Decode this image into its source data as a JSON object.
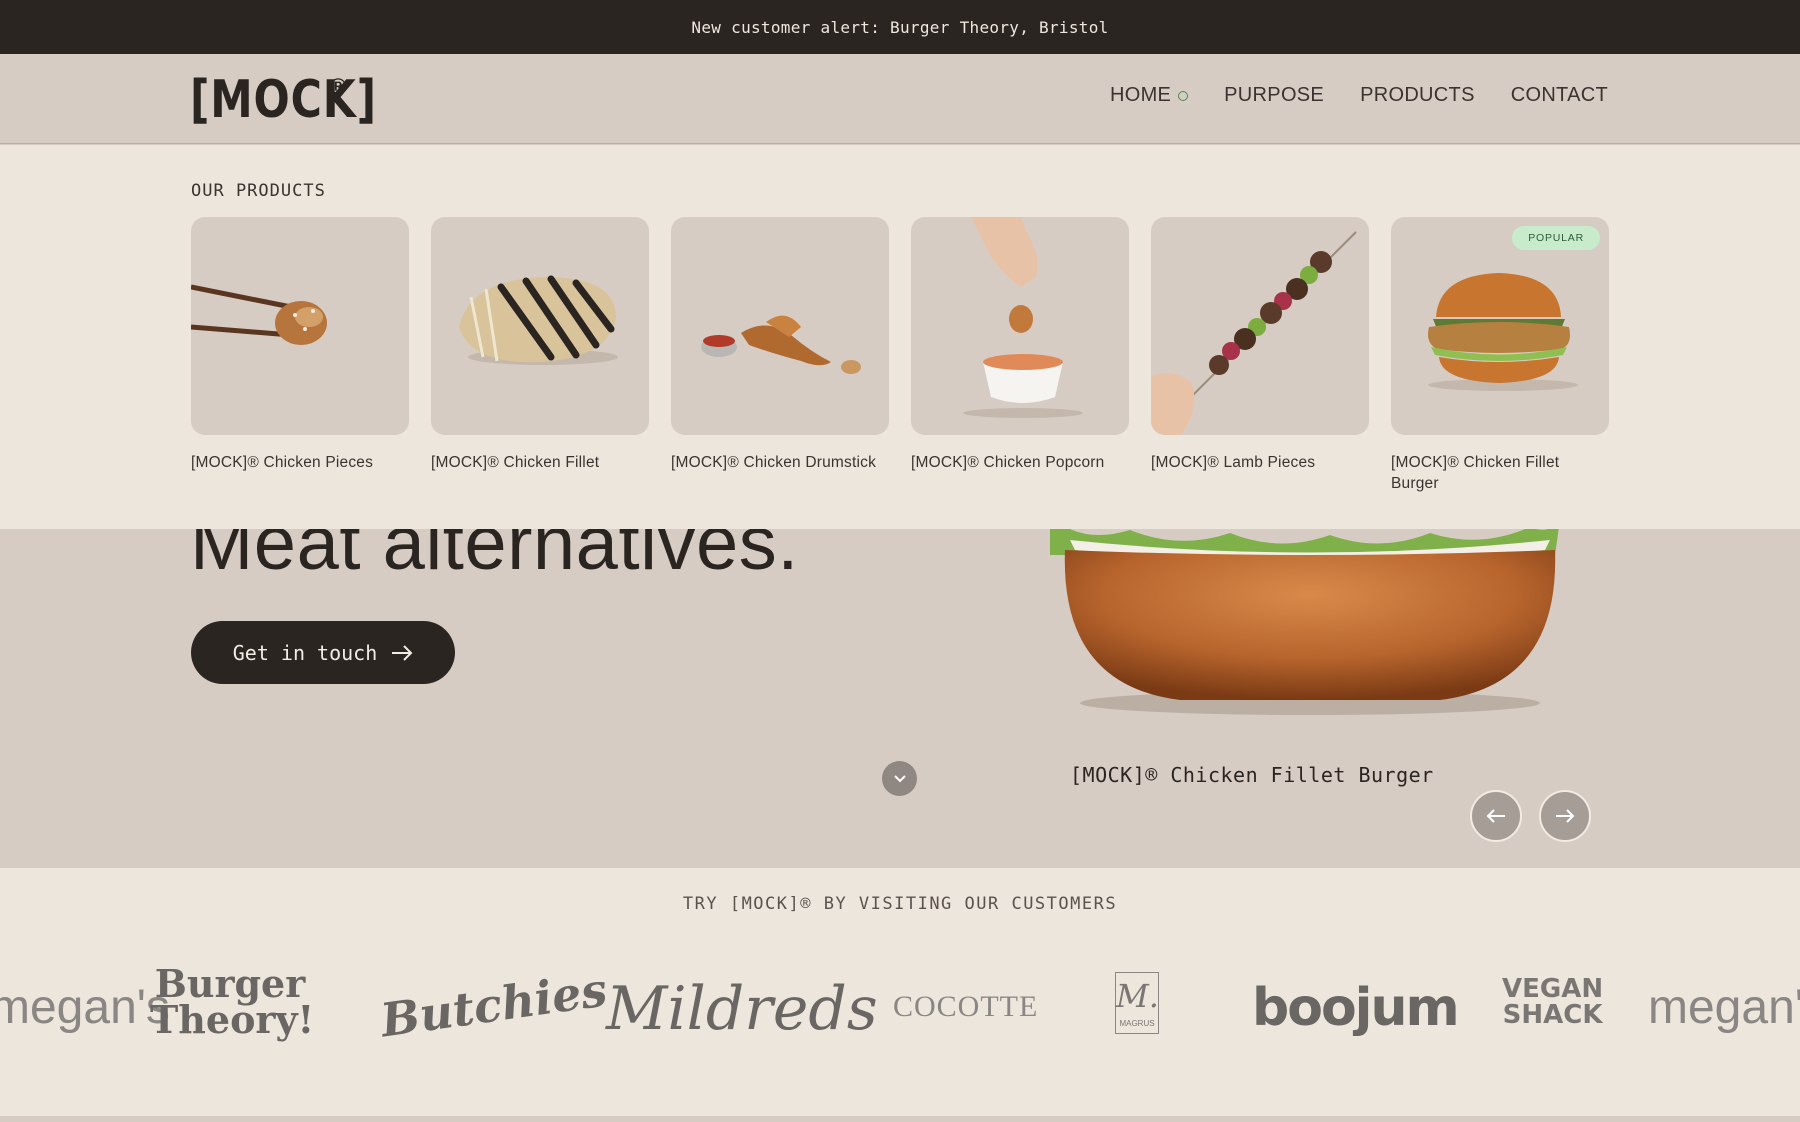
{
  "announcement": "New customer alert: Burger Theory, Bristol",
  "brand": {
    "logo_text": "[MOCK]",
    "logo_mark": "®"
  },
  "nav": {
    "items": [
      {
        "label": "HOME",
        "active": true
      },
      {
        "label": "PURPOSE"
      },
      {
        "label": "PRODUCTS"
      },
      {
        "label": "CONTACT"
      }
    ]
  },
  "products_panel": {
    "title": "OUR PRODUCTS",
    "products": [
      {
        "name": "[MOCK]® Chicken Pieces"
      },
      {
        "name": "[MOCK]® Chicken Fillet"
      },
      {
        "name": "[MOCK]® Chicken Drumstick"
      },
      {
        "name": "[MOCK]® Chicken Popcorn"
      },
      {
        "name": "[MOCK]® Lamb Pieces"
      },
      {
        "name": "[MOCK]® Chicken Fillet Burger",
        "badge": "POPULAR"
      }
    ]
  },
  "hero": {
    "heading": "Meat alternatives.",
    "cta_label": "Get in touch",
    "caption": "[MOCK]® Chicken Fillet Burger"
  },
  "customers": {
    "title": "TRY [MOCK]® BY VISITING OUR CUSTOMERS",
    "logos": [
      "megan's",
      "Burger Theory!",
      "Butchies",
      "Mildreds",
      "COCOTTE",
      "M.",
      "MAGRUS",
      "boojum",
      "VEGAN",
      "SHACK",
      "megan's"
    ]
  },
  "colors": {
    "dark": "#2b2522",
    "beige": "#d7ccc3",
    "cream": "#ede6dd",
    "popular_badge": "#c8ebcb",
    "active_dot": "#4c8a55"
  }
}
